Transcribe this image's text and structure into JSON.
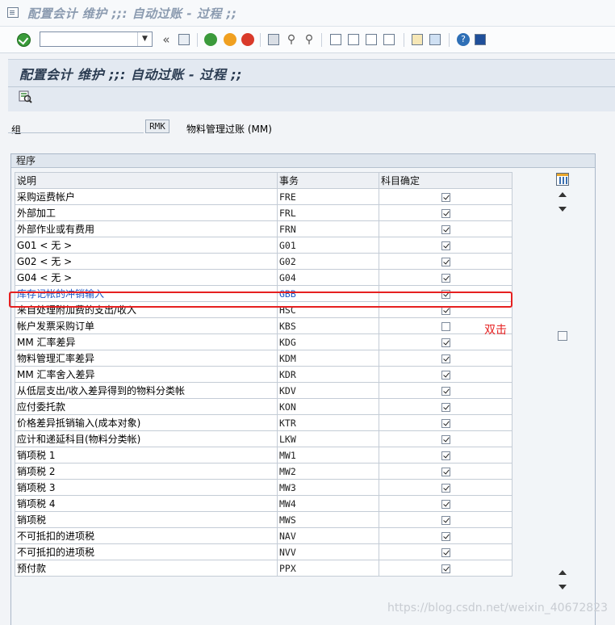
{
  "window": {
    "title": "配置会计 维护 ;;: 自动过账 - 过程 ;;"
  },
  "toolbar": {
    "command_value": "",
    "back_glyph": "«"
  },
  "header": {
    "title": "配置会计 维护 ;;: 自动过账 - 过程 ;;"
  },
  "group": {
    "label": "组",
    "value": "RMK",
    "description": "物料管理过账 (MM)"
  },
  "section": {
    "title": "程序"
  },
  "table": {
    "columns": [
      "说明",
      "事务",
      "科目确定"
    ],
    "rows": [
      {
        "desc": "采购运费帐户",
        "code": "FRE",
        "checked": true
      },
      {
        "desc": "外部加工",
        "code": "FRL",
        "checked": true
      },
      {
        "desc": "外部作业或有费用",
        "code": "FRN",
        "checked": true
      },
      {
        "desc": "G01 < 无 >",
        "code": "G01",
        "checked": true
      },
      {
        "desc": "G02 < 无 >",
        "code": "G02",
        "checked": true
      },
      {
        "desc": "G04 < 无 >",
        "code": "G04",
        "checked": true
      },
      {
        "desc": "库存记帐的冲销输入",
        "code": "GBB",
        "checked": true,
        "selected": true
      },
      {
        "desc": "来自处理附加费的支出/收入",
        "code": "HSC",
        "checked": true
      },
      {
        "desc": "帐户发票采购订单",
        "code": "KBS",
        "checked": false
      },
      {
        "desc": "MM 汇率差异",
        "code": "KDG",
        "checked": true
      },
      {
        "desc": "物料管理汇率差异",
        "code": "KDM",
        "checked": true
      },
      {
        "desc": "MM 汇率舍入差异",
        "code": "KDR",
        "checked": true
      },
      {
        "desc": "从低层支出/收入差异得到的物料分类帐",
        "code": "KDV",
        "checked": true
      },
      {
        "desc": "应付委托款",
        "code": "KON",
        "checked": true
      },
      {
        "desc": "价格差异抵销输入(成本对象)",
        "code": "KTR",
        "checked": true
      },
      {
        "desc": "应计和递延科目(物料分类帐)",
        "code": "LKW",
        "checked": true
      },
      {
        "desc": "销项税 1",
        "code": "MW1",
        "checked": true
      },
      {
        "desc": "销项税 2",
        "code": "MW2",
        "checked": true
      },
      {
        "desc": "销项税 3",
        "code": "MW3",
        "checked": true
      },
      {
        "desc": "销项税 4",
        "code": "MW4",
        "checked": true
      },
      {
        "desc": "销项税",
        "code": "MWS",
        "checked": true
      },
      {
        "desc": "不可抵扣的进项税",
        "code": "NAV",
        "checked": true
      },
      {
        "desc": "不可抵扣的进项税",
        "code": "NVV",
        "checked": true
      },
      {
        "desc": "预付款",
        "code": "PPX",
        "checked": true
      }
    ]
  },
  "annotation": {
    "text": "双击",
    "color": "#e62020"
  },
  "watermark": {
    "text": "https://blog.csdn.net/weixin_40672823"
  },
  "colors": {
    "header_bg": "#e3e9f1",
    "highlight": "#e62020",
    "link": "#1a56c4"
  }
}
